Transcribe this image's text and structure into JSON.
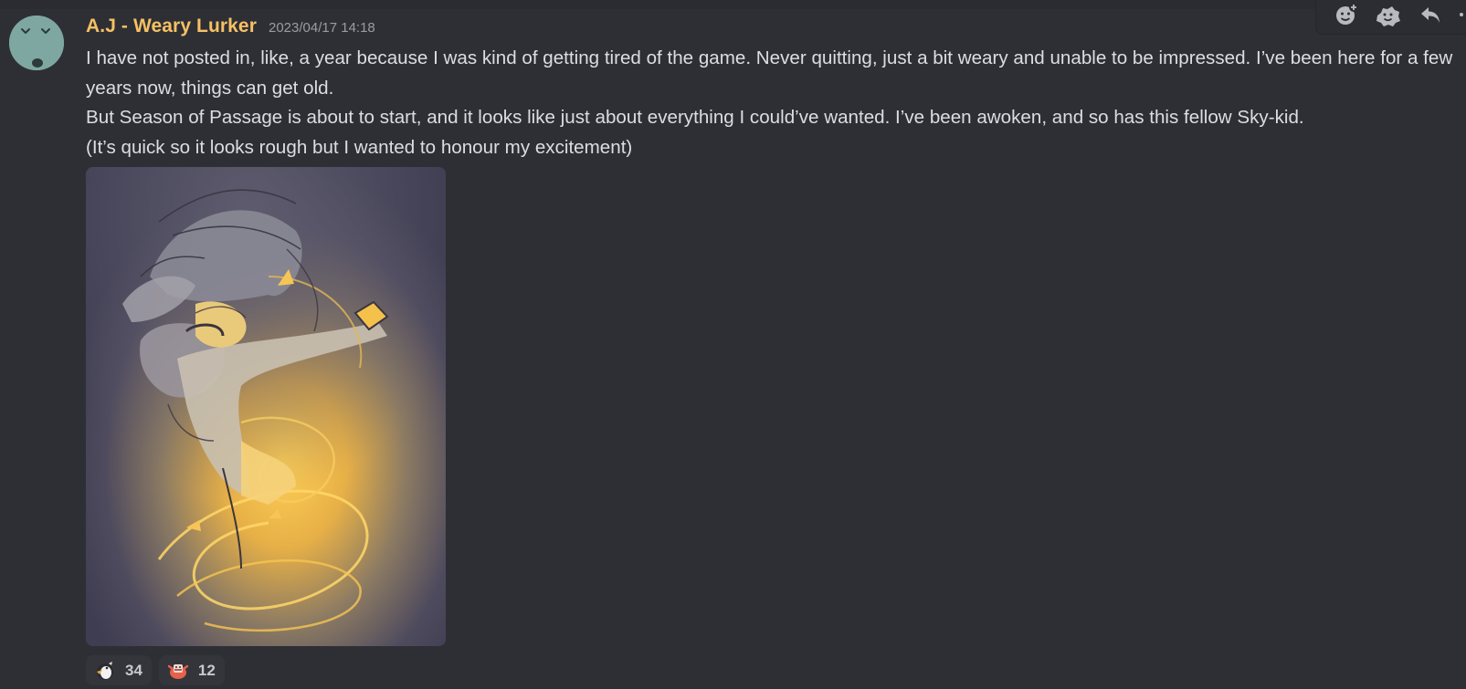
{
  "message": {
    "author": "A.J - Weary Lurker",
    "timestamp": "2023/04/17 14:18",
    "lines": [
      "I have not posted in, like, a year because I was kind of getting tired of the game. Never quitting, just a bit weary and unable to be impressed. I’ve been here for a few years now, things can get old.",
      "But Season of Passage is about to start, and it looks like just about everything I could’ve wanted. I’ve been awoken, and so has this fellow Sky-kid.",
      "(It’s quick so it looks rough but I wanted to honour my excitement)"
    ],
    "attachment": {
      "kind": "image",
      "description_icon": "artwork-image"
    },
    "reactions": [
      {
        "icon": "penguin-emoji",
        "count": "34"
      },
      {
        "icon": "crab-emoji",
        "count": "12"
      }
    ]
  },
  "toolbar": {
    "items": [
      {
        "icon": "add-reaction-icon"
      },
      {
        "icon": "super-reaction-icon"
      },
      {
        "icon": "reply-icon"
      },
      {
        "icon": "more-icon"
      }
    ]
  },
  "colors": {
    "background": "#2e2f35",
    "username": "#f6c163",
    "text": "#dbdee1",
    "timestamp": "#9a9ca2",
    "avatar": "#7fa7a2",
    "glow": "#f5b93c"
  }
}
